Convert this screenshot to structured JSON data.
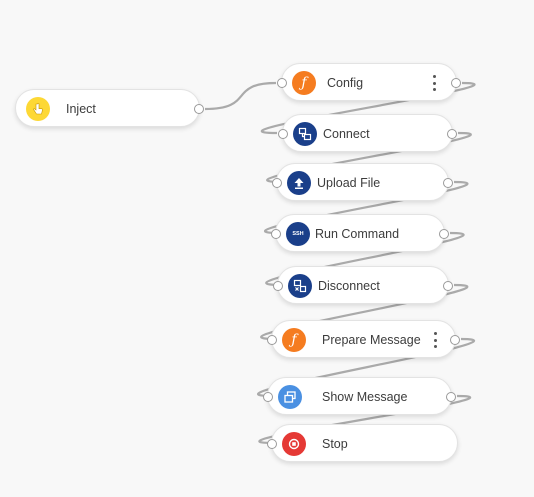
{
  "nodes": {
    "inject": {
      "label": "Inject",
      "icon": "hand-pointer-icon",
      "color": "#fdd835"
    },
    "config": {
      "label": "Config",
      "icon": "function-icon",
      "color": "#f57c20"
    },
    "connect": {
      "label": "Connect",
      "icon": "network-icon",
      "color": "#1a3f8a"
    },
    "upload_file": {
      "label": "Upload File",
      "icon": "upload-icon",
      "color": "#1a3f8a"
    },
    "run_command": {
      "label": "Run Command",
      "icon": "ssh-icon",
      "icon_text": "SSH",
      "color": "#1a3f8a"
    },
    "disconnect": {
      "label": "Disconnect",
      "icon": "network-disconnect-icon",
      "color": "#1a3f8a"
    },
    "prepare_message": {
      "label": "Prepare Message",
      "icon": "function-icon",
      "color": "#f57c20"
    },
    "show_message": {
      "label": "Show Message",
      "icon": "window-icon",
      "color": "#4a90e2"
    },
    "stop": {
      "label": "Stop",
      "icon": "stop-icon",
      "color": "#e53935"
    }
  },
  "wire_color": "#aaaaaa"
}
